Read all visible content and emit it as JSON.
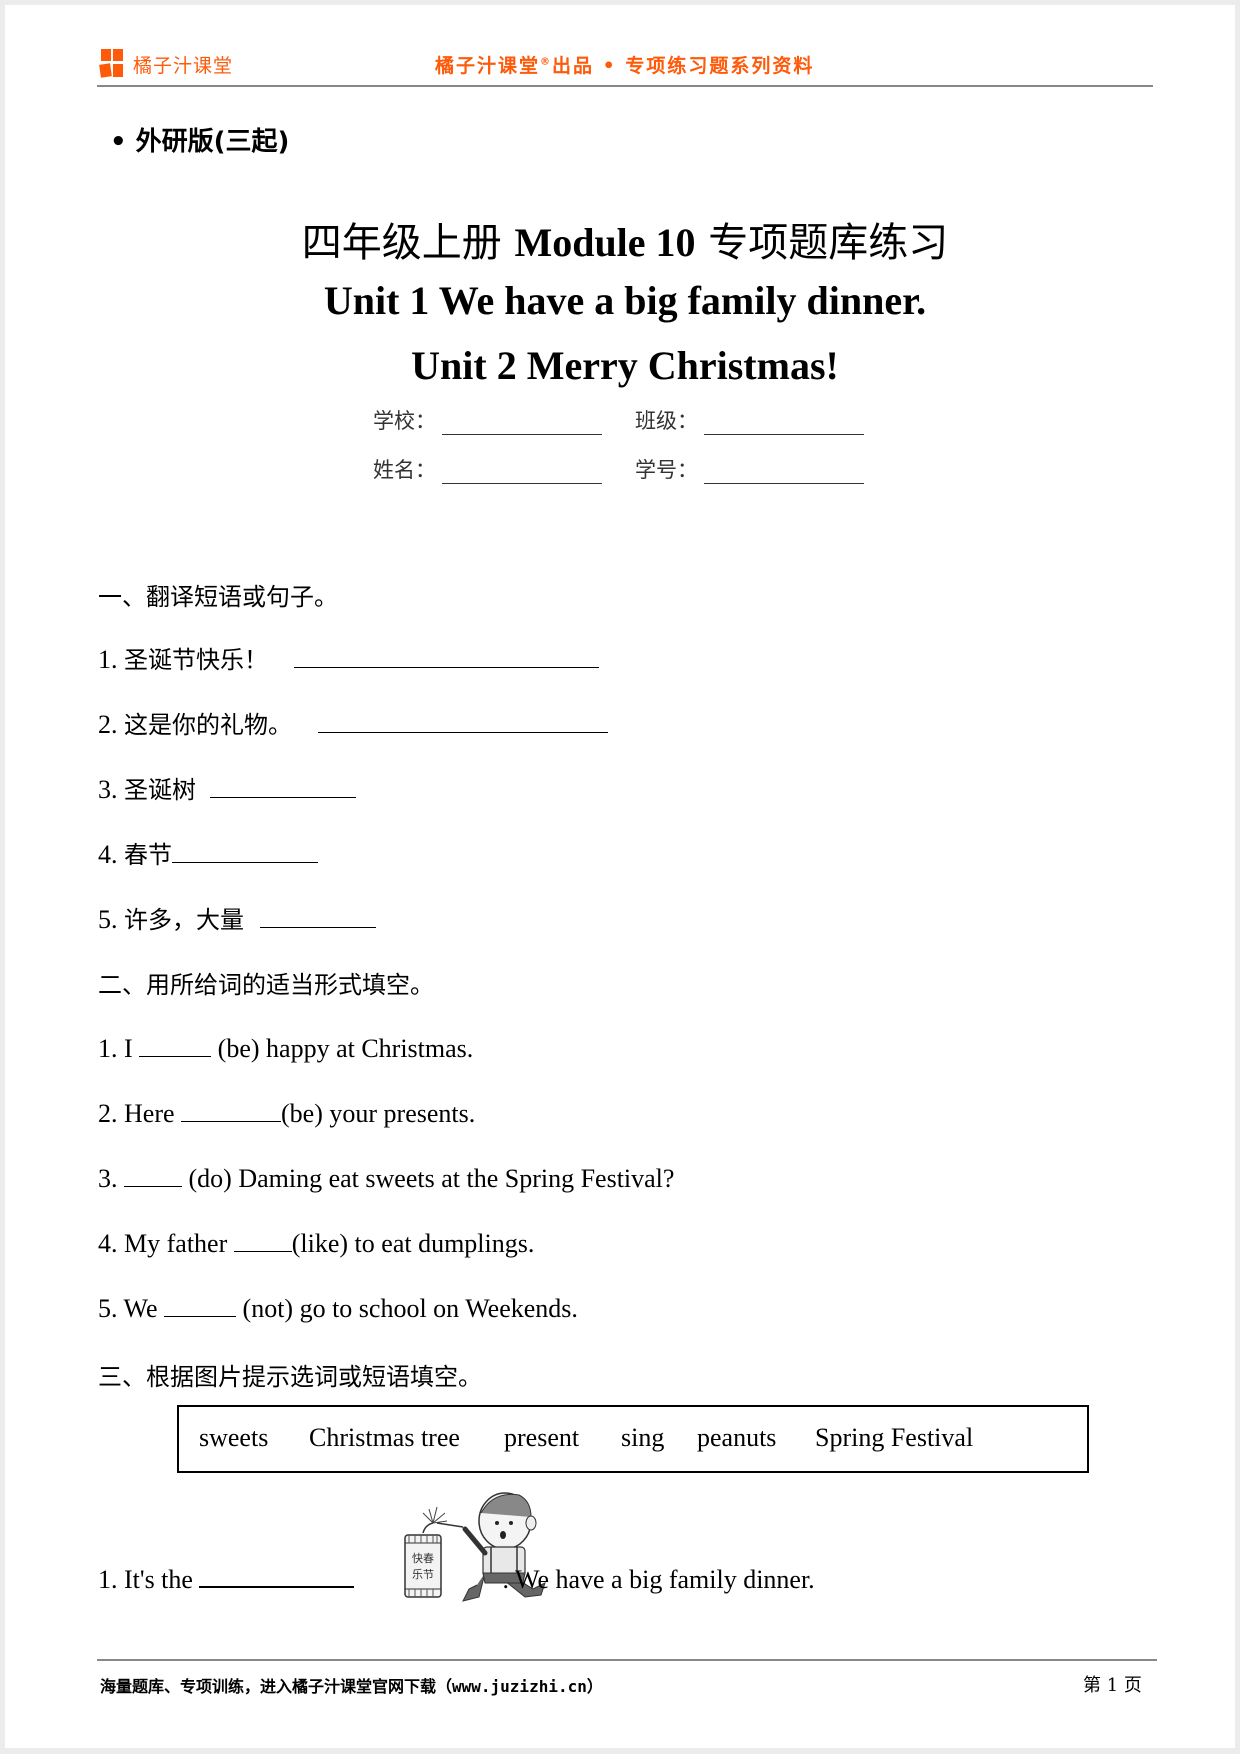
{
  "header": {
    "brand": "橘子汁课堂",
    "tagline_pre": "橘子汁课堂",
    "tagline_reg": "®",
    "tagline_post": "出品 • 专项练习题系列资料",
    "brand_color": "#ff5a0a"
  },
  "edition": "• 外研版(三起)",
  "title": {
    "line1_cn_left": "四年级上册 ",
    "line1_en": "Module 10",
    "line1_cn_right": " 专项题库练习",
    "line2": "Unit 1 We have a big family dinner.",
    "line3": "Unit 2 Merry Christmas!"
  },
  "info_fields": {
    "school": "学校：",
    "class": "班级：",
    "name": "姓名：",
    "number": "学号："
  },
  "section1": {
    "heading": "一、翻译短语或句子。",
    "items": [
      {
        "num": "1.",
        "text": "圣诞节快乐！"
      },
      {
        "num": "2.",
        "text": "这是你的礼物。"
      },
      {
        "num": "3.",
        "text": "圣诞树"
      },
      {
        "num": "4.",
        "text": "春节"
      },
      {
        "num": "5.",
        "text": "许多，大量"
      }
    ]
  },
  "section2": {
    "heading": "二、用所给词的适当形式填空。",
    "items": [
      {
        "pre": "1. I ",
        "post": " (be) happy at Christmas."
      },
      {
        "pre": "2. Here ",
        "post": "(be) your presents."
      },
      {
        "pre": "3. ",
        "post": " (do) Daming eat sweets at the Spring Festival?"
      },
      {
        "pre": "4. My father ",
        "post": "(like) to eat dumplings."
      },
      {
        "pre": "5. We ",
        "post": " (not) go to school on Weekends."
      }
    ]
  },
  "section3": {
    "heading": "三、根据图片提示选词或短语填空。",
    "word_bank": [
      "sweets",
      "Christmas tree",
      "present",
      "sing",
      "peanuts",
      "Spring Festival"
    ],
    "items": [
      {
        "pre": "1. It's the ",
        "post": ". We have a big family dinner.",
        "image": "boy-lighting-firecracker-illustration",
        "firecracker_text": [
          "快春",
          "乐节"
        ]
      }
    ]
  },
  "footer": {
    "left": "海量题库、专项训练，进入橘子汁课堂官网下载（www.juzizhi.cn）",
    "page_label": "第 1 页"
  }
}
